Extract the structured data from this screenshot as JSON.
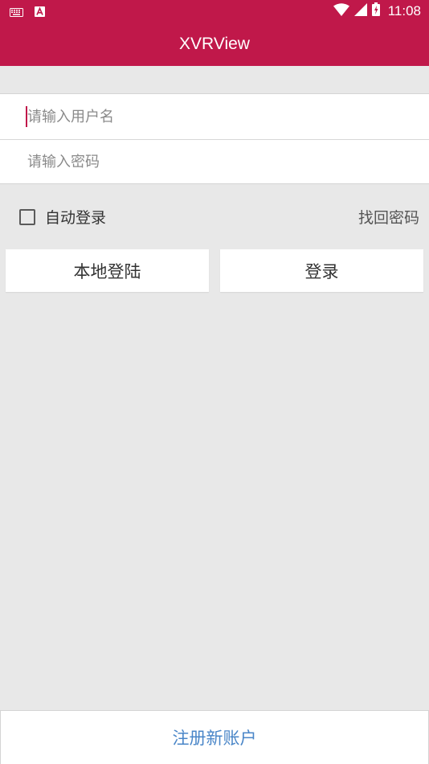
{
  "status_bar": {
    "time": "11:08",
    "icons": [
      "keyboard-icon",
      "a-notification-icon",
      "wifi-icon",
      "signal-icon",
      "battery-icon"
    ]
  },
  "app_bar": {
    "title": "XVRView"
  },
  "login_form": {
    "username_placeholder": "请输入用户名",
    "password_placeholder": "请输入密码",
    "auto_login_label": "自动登录",
    "auto_login_checked": false,
    "forgot_password_label": "找回密码",
    "local_login_label": "本地登陆",
    "login_label": "登录"
  },
  "footer": {
    "register_label": "注册新账户"
  },
  "colors": {
    "primary": "#c0184a",
    "background": "#e8e8e8",
    "link": "#4a86c8"
  }
}
